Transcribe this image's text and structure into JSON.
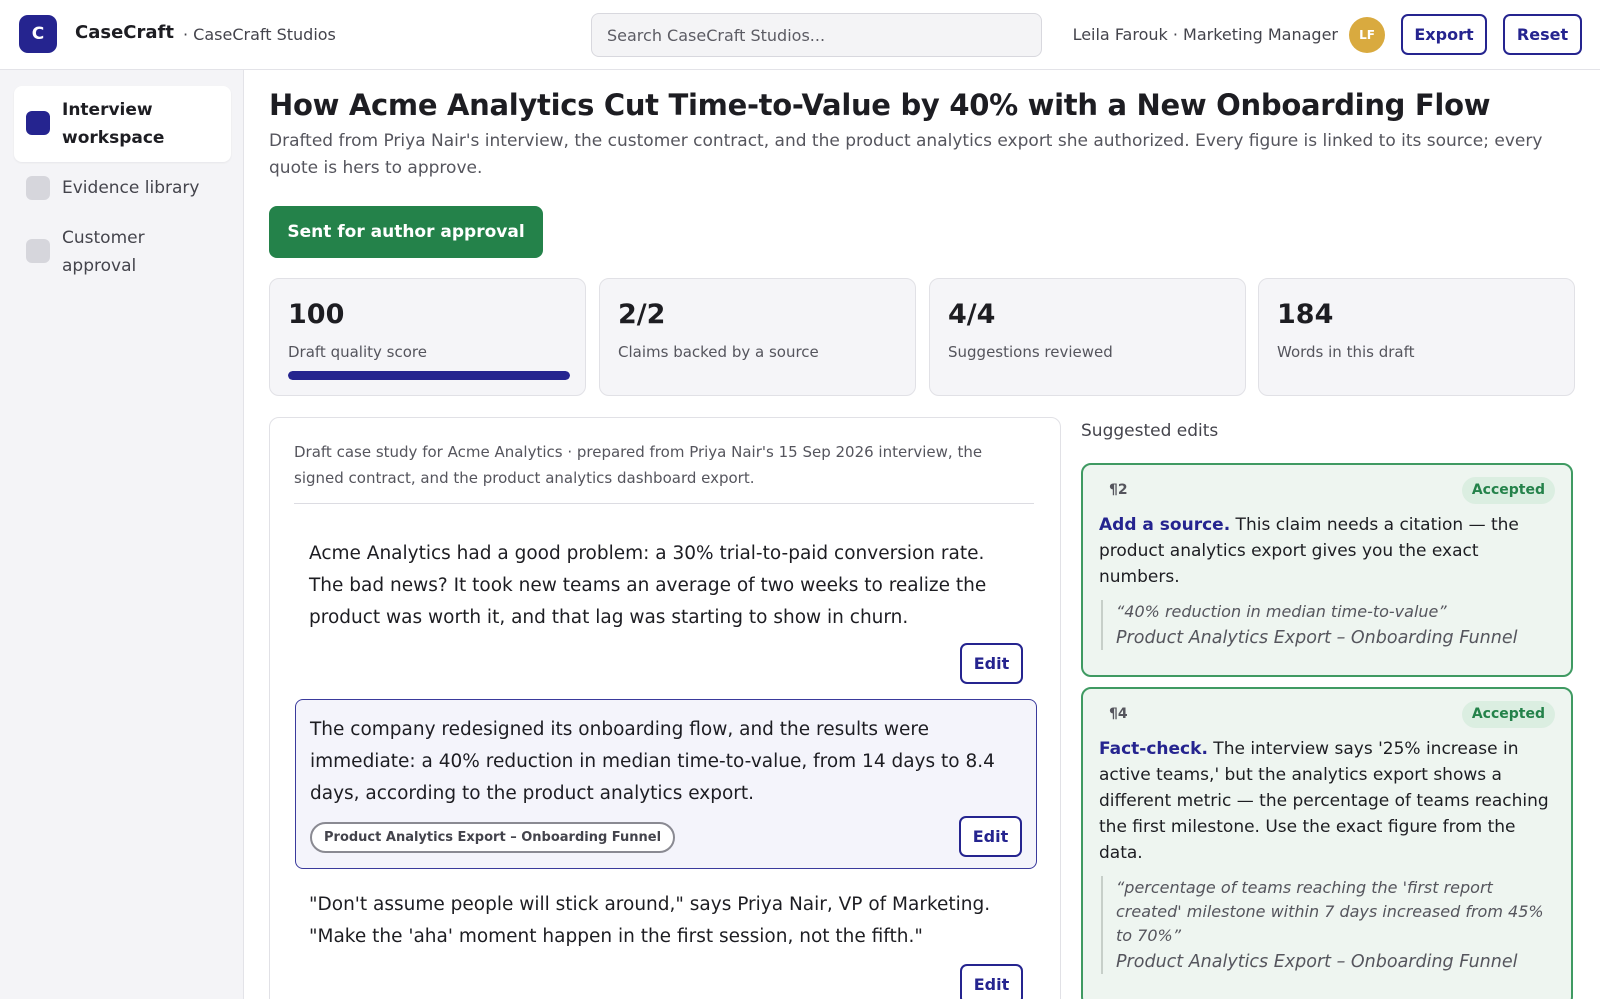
{
  "header": {
    "logo_letter": "C",
    "brand": "CaseCraft",
    "workspace": "· CaseCraft Studios",
    "search_placeholder": "Search CaseCraft Studios...",
    "user": "Leila Farouk · Marketing Manager",
    "avatar_initials": "LF",
    "export_label": "Export",
    "reset_label": "Reset"
  },
  "sidebar": {
    "items": [
      {
        "label": "Interview workspace",
        "active": true
      },
      {
        "label": "Evidence library",
        "active": false
      },
      {
        "label": "Customer approval",
        "active": false
      }
    ]
  },
  "main": {
    "title": "How Acme Analytics Cut Time-to-Value by 40% with a New Onboarding Flow",
    "subtitle": "Drafted from Priya Nair's interview, the customer contract, and the product analytics export she authorized. Every figure is linked to its source; every quote is hers to approve.",
    "status_button": "Sent for author approval",
    "stats": [
      {
        "value": "100",
        "label": "Draft quality score",
        "progress": 1.0
      },
      {
        "value": "2/2",
        "label": "Claims backed by a source"
      },
      {
        "value": "4/4",
        "label": "Suggestions reviewed"
      },
      {
        "value": "184",
        "label": "Words in this draft"
      }
    ]
  },
  "draft": {
    "intro": "Draft case study for Acme Analytics · prepared from Priya Nair's 15 Sep 2026 interview, the signed contract, and the product analytics dashboard export.",
    "edit_label": "Edit",
    "paragraphs": [
      {
        "text": "Acme Analytics had a good problem: a 30% trial-to-paid conversion rate. The bad news? It took new teams an average of two weeks to realize the product was worth it, and that lag was starting to show in churn."
      },
      {
        "text": "The company redesigned its onboarding flow, and the results were immediate: a 40% reduction in median time-to-value, from 14 days to 8.4 days, according to the product analytics export.",
        "source": "Product Analytics Export – Onboarding Funnel"
      },
      {
        "text": "\"Don't assume people will stick around,\" says Priya Nair, VP of Marketing. \"Make the 'aha' moment happen in the first session, not the fifth.\""
      }
    ]
  },
  "suggestions": {
    "heading": "Suggested edits",
    "items": [
      {
        "para": "¶2",
        "status": "Accepted",
        "title": "Add a source.",
        "body": " This claim needs a citation — the product analytics export gives you the exact numbers.",
        "quote": "“40% reduction in median time-to-value”",
        "source": "Product Analytics Export – Onboarding Funnel"
      },
      {
        "para": "¶4",
        "status": "Accepted",
        "title": "Fact-check.",
        "body": " The interview says '25% increase in active teams,' but the analytics export shows a different metric — the percentage of teams reaching the first milestone. Use the exact figure from the data.",
        "quote": "“percentage of teams reaching the 'first report created' milestone within 7 days increased from 45% to 70%”",
        "source": "Product Analytics Export – Onboarding Funnel"
      }
    ]
  },
  "colors": {
    "brand": "#25248f",
    "success": "#24824a",
    "avatar": "#d9aa3f"
  }
}
